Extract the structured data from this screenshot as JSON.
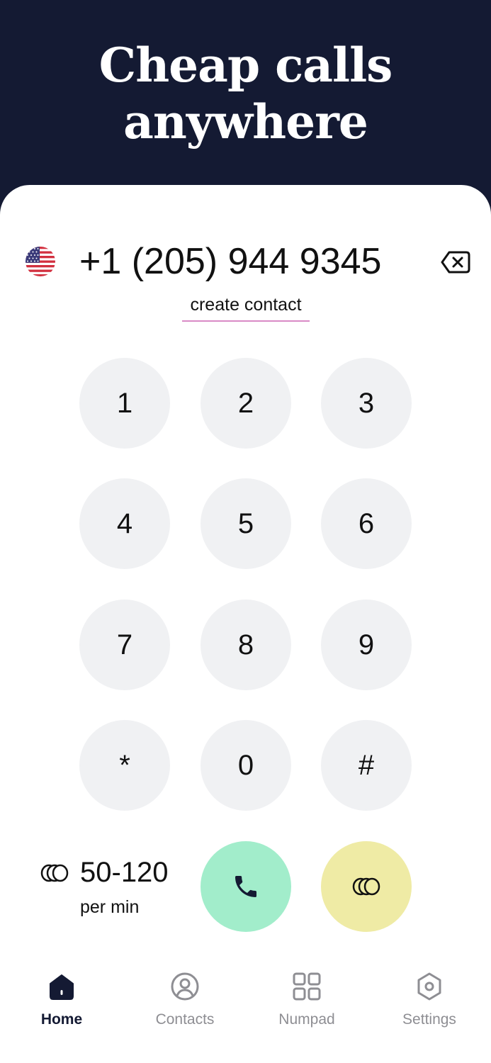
{
  "hero": {
    "title_line1": "Cheap calls",
    "title_line2": "anywhere"
  },
  "dialer": {
    "country_flag": "us-flag-icon",
    "number": "+1 (205) 944 9345",
    "create_contact_label": "create contact"
  },
  "keypad": {
    "keys": [
      "1",
      "2",
      "3",
      "4",
      "5",
      "6",
      "7",
      "8",
      "9",
      "*",
      "0",
      "#"
    ]
  },
  "rate": {
    "value": "50-120",
    "unit": "per min"
  },
  "nav": {
    "items": [
      {
        "label": "Home",
        "icon": "home-icon",
        "active": true
      },
      {
        "label": "Contacts",
        "icon": "contact-circle-icon",
        "active": false
      },
      {
        "label": "Numpad",
        "icon": "grid-icon",
        "active": false
      },
      {
        "label": "Settings",
        "icon": "hexagon-gear-icon",
        "active": false
      }
    ]
  },
  "colors": {
    "header_bg": "#141a33",
    "key_bg": "#f0f1f3",
    "call_button": "#a2edcb",
    "credit_button": "#efeba5",
    "link_underline": "#d98ac6",
    "nav_inactive": "#8e8e93"
  }
}
